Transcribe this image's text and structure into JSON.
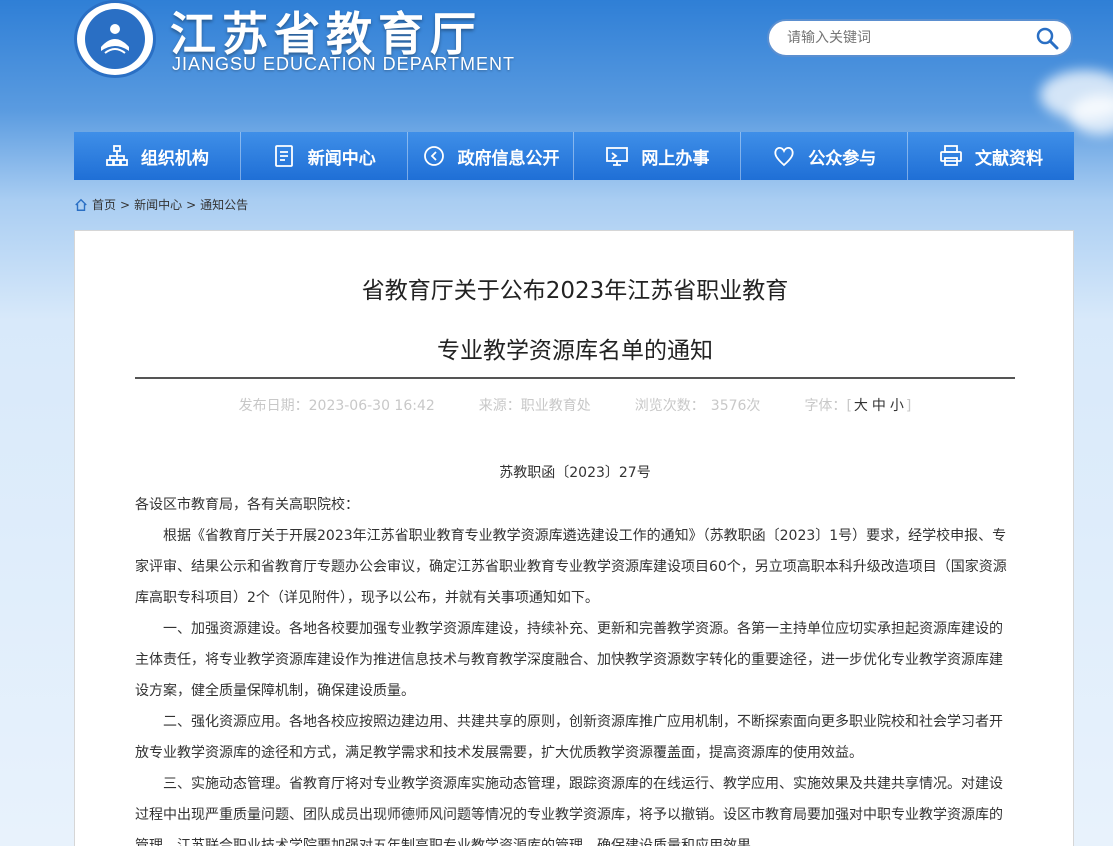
{
  "header": {
    "title": "江苏省教育厅",
    "subtitle": "JIANGSU EDUCATION DEPARTMENT"
  },
  "search": {
    "placeholder": "请输入关键词",
    "icon": "search-icon"
  },
  "nav": {
    "items": [
      {
        "label": "组织机构",
        "icon": "org-chart-icon"
      },
      {
        "label": "新闻中心",
        "icon": "document-icon"
      },
      {
        "label": "政府信息公开",
        "icon": "chevron-circle-icon"
      },
      {
        "label": "网上办事",
        "icon": "monitor-icon"
      },
      {
        "label": "公众参与",
        "icon": "heart-icon"
      },
      {
        "label": "文献资料",
        "icon": "printer-icon"
      }
    ]
  },
  "breadcrumb": {
    "home": "首页",
    "sep1": ">",
    "level1": "新闻中心",
    "sep2": ">",
    "level2": "通知公告"
  },
  "article": {
    "title_line1": "省教育厅关于公布2023年江苏省职业教育",
    "title_line2": "专业教学资源库名单的通知",
    "meta": {
      "publish_label": "发布日期：",
      "publish_date": "2023-06-30 16:42",
      "source_label": "来源：",
      "source": "职业教育处",
      "views_label": "浏览次数：",
      "views": "3576次",
      "font_label": "字体：",
      "font_open": "[",
      "font_large": "大",
      "font_medium": "中",
      "font_small": "小",
      "font_close": "]"
    },
    "doc_number": "苏教职函〔2023〕27号",
    "salutation": "各设区市教育局，各有关高职院校：",
    "paragraphs": [
      "根据《省教育厅关于开展2023年江苏省职业教育专业教学资源库遴选建设工作的通知》（苏教职函〔2023〕1号）要求，经学校申报、专家评审、结果公示和省教育厅专题办公会审议，确定江苏省职业教育专业教学资源库建设项目60个，另立项高职本科升级改造项目（国家资源库高职专科项目）2个（详见附件），现予以公布，并就有关事项通知如下。",
      "一、加强资源建设。各地各校要加强专业教学资源库建设，持续补充、更新和完善教学资源。各第一主持单位应切实承担起资源库建设的主体责任，将专业教学资源库建设作为推进信息技术与教育教学深度融合、加快教学资源数字转化的重要途径，进一步优化专业教学资源库建设方案，健全质量保障机制，确保建设质量。",
      "二、强化资源应用。各地各校应按照边建边用、共建共享的原则，创新资源库推广应用机制，不断探索面向更多职业院校和社会学习者开放专业教学资源库的途径和方式，满足教学需求和技术发展需要，扩大优质教学资源覆盖面，提高资源库的使用效益。",
      "三、实施动态管理。省教育厅将对专业教学资源库实施动态管理，跟踪资源库的在线运行、教学应用、实施效果及共建共享情况。对建设过程中出现严重质量问题、团队成员出现师德师风问题等情况的专业教学资源库，将予以撤销。设区市教育局要加强对中职专业教学资源库的管理，江苏联合职业技术学院要加强对五年制高职专业教学资源库的管理，确保建设质量和应用效果。"
    ]
  }
}
